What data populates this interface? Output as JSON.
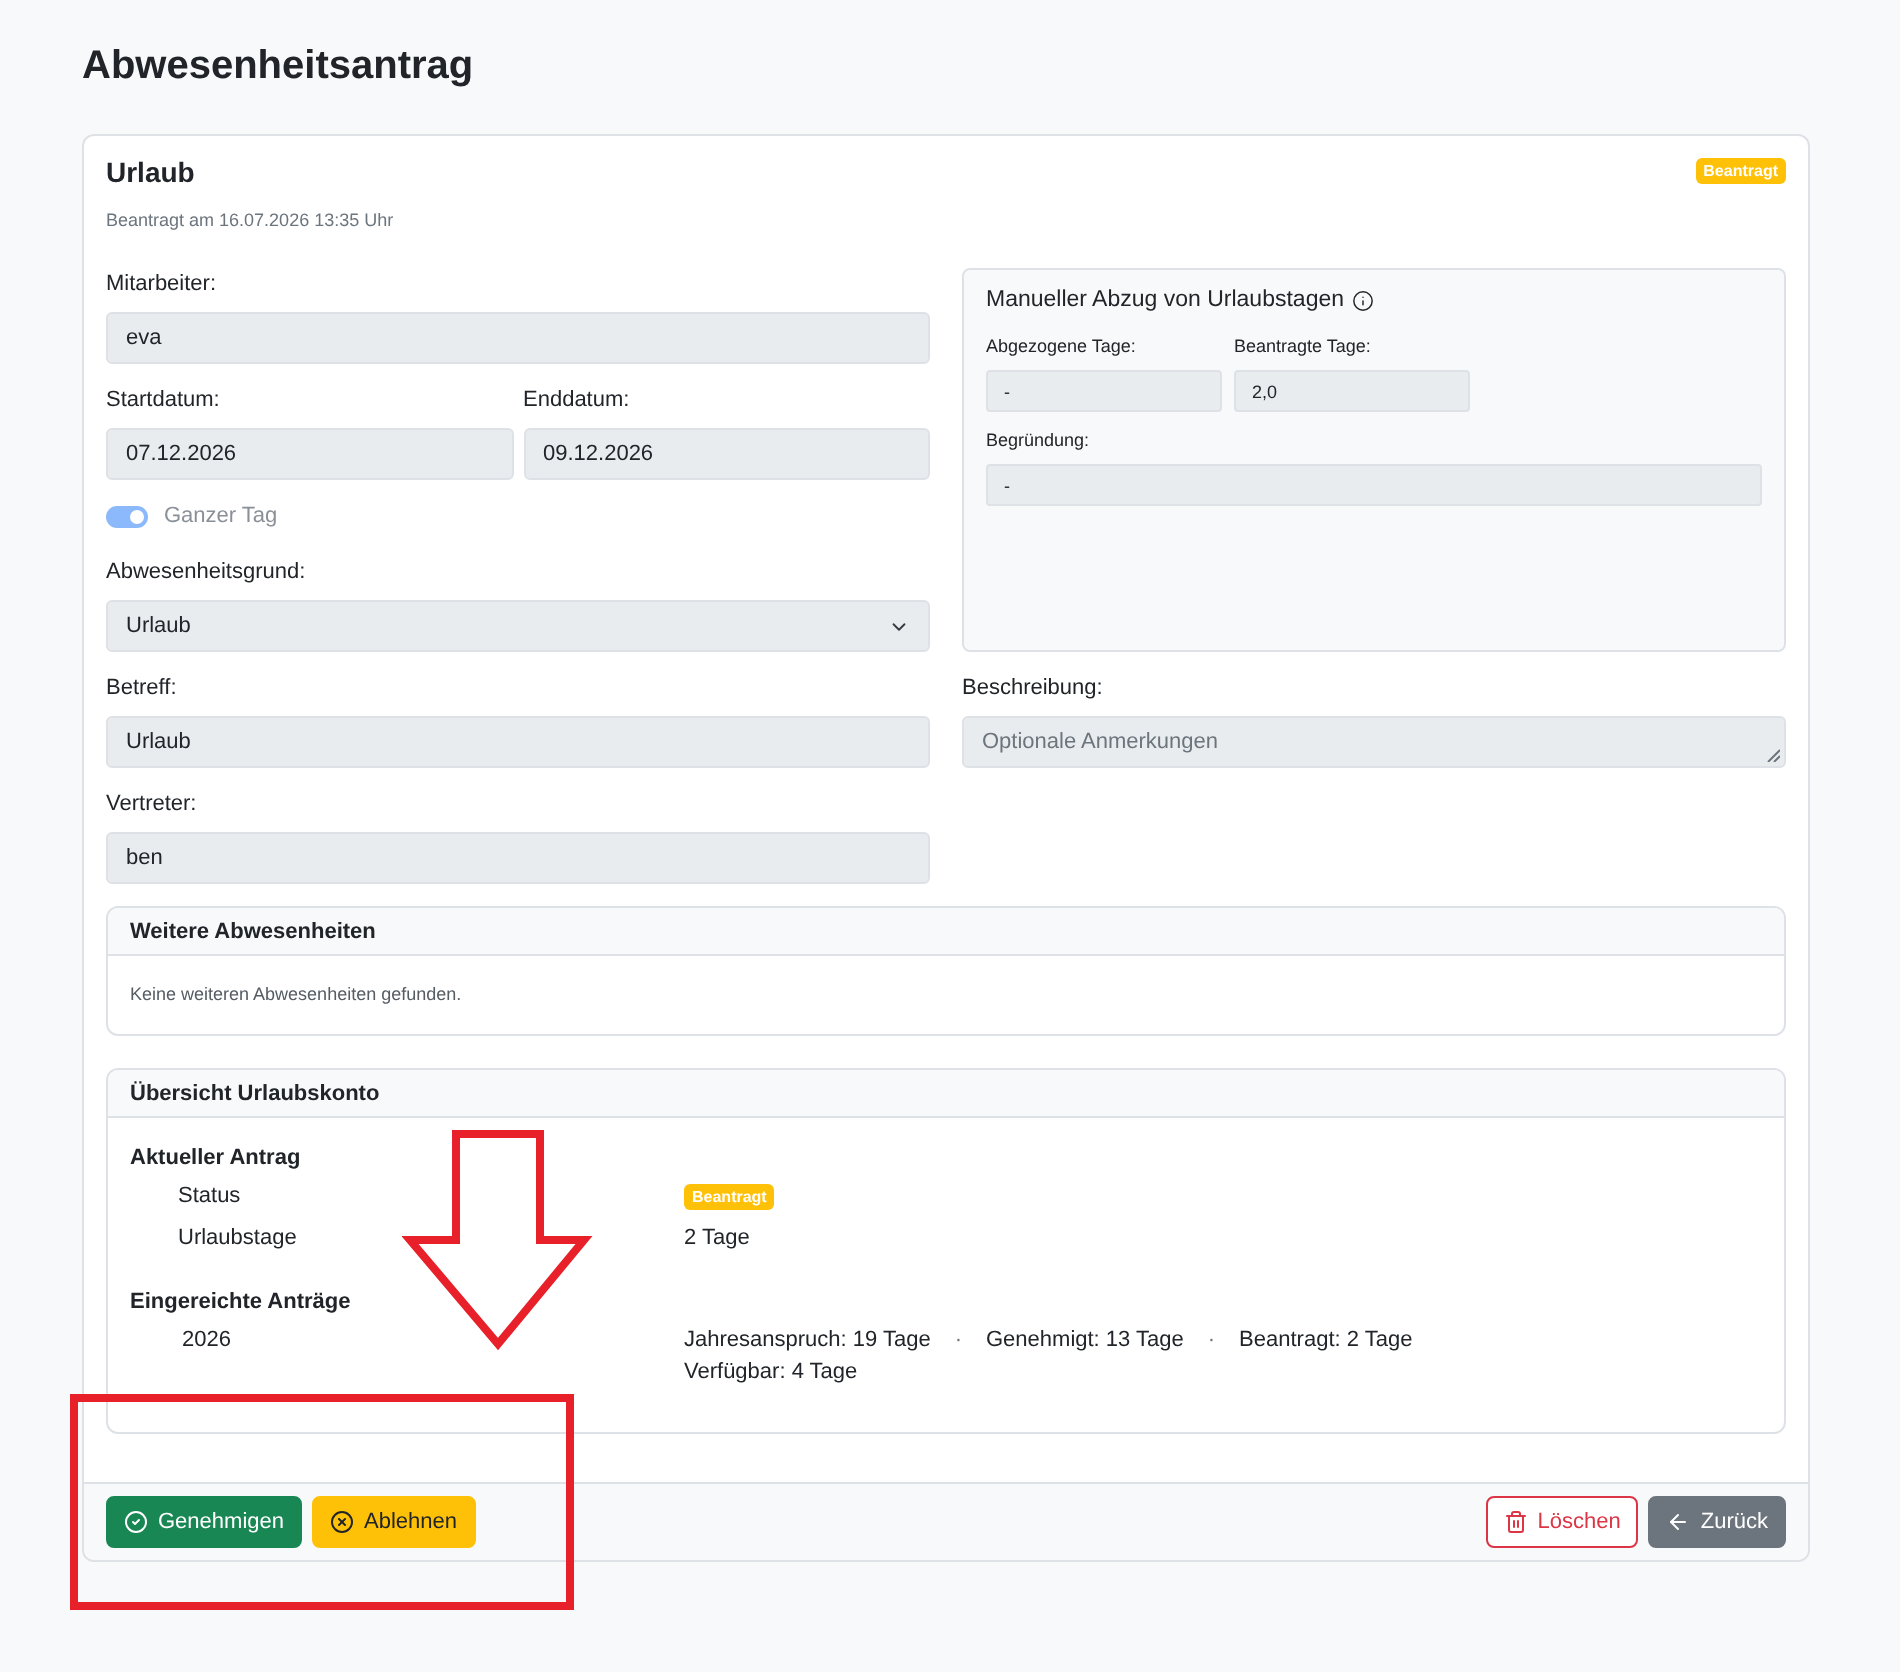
{
  "page": {
    "title": "Abwesenheitsantrag"
  },
  "request": {
    "title": "Urlaub",
    "status": "Beantragt",
    "submitted": "Beantragt am 16.07.2026 13:35 Uhr"
  },
  "employee": {
    "label": "Mitarbeiter:",
    "value": "eva"
  },
  "start_date": {
    "label": "Startdatum:",
    "value": "07.12.2026"
  },
  "end_date": {
    "label": "Enddatum:",
    "value": "09.12.2026"
  },
  "full_day": {
    "label": "Ganzer Tag",
    "on": true,
    "disabled": true
  },
  "reason": {
    "label": "Abwesenheitsgrund:",
    "value": "Urlaub"
  },
  "subject": {
    "label": "Betreff:",
    "value": "Urlaub"
  },
  "substitute": {
    "label": "Vertreter:",
    "value": "ben"
  },
  "manual_deduction": {
    "title": "Manueller Abzug von Urlaubstagen",
    "deducted": {
      "label": "Abgezogene Tage:",
      "value": "-"
    },
    "requested": {
      "label": "Beantragte Tage:",
      "value": "2,0"
    },
    "justification": {
      "label": "Begründung:",
      "value": "-"
    }
  },
  "description": {
    "label": "Beschreibung:",
    "placeholder": "Optionale Anmerkungen"
  },
  "other_absences": {
    "title": "Weitere Abwesenheiten",
    "empty_text": "Keine weiteren Abwesenheiten gefunden."
  },
  "vacation_account": {
    "title": "Übersicht Urlaubskonto",
    "current": {
      "heading": "Aktueller Antrag",
      "rows": [
        {
          "kind": "badge",
          "label": "Status",
          "value": "Beantragt"
        },
        {
          "kind": "text",
          "label": "Urlaubstage",
          "value": "2 Tage"
        }
      ]
    },
    "submitted": {
      "heading": "Eingereichte Anträge",
      "years": [
        {
          "year": "2026",
          "lines": [
            [
              {
                "kind": "stat",
                "text": "Jahresanspruch: 19 Tage"
              },
              {
                "kind": "separator",
                "text": "·"
              },
              {
                "kind": "stat",
                "text": "Genehmigt: 13 Tage"
              },
              {
                "kind": "separator",
                "text": "·"
              },
              {
                "kind": "stat",
                "text": "Beantragt: 2 Tage"
              }
            ],
            [
              {
                "kind": "stat",
                "text": "Verfügbar: 4 Tage"
              }
            ]
          ]
        }
      ]
    }
  },
  "actions_left": [
    {
      "kind": "approve",
      "label": "Genehmigen"
    },
    {
      "kind": "reject",
      "label": "Ablehnen"
    }
  ],
  "actions_right": [
    {
      "kind": "delete",
      "label": "Löschen"
    },
    {
      "kind": "back",
      "label": "Zurück"
    }
  ],
  "annotations": {
    "arrow": true,
    "highlight_frame": true
  }
}
